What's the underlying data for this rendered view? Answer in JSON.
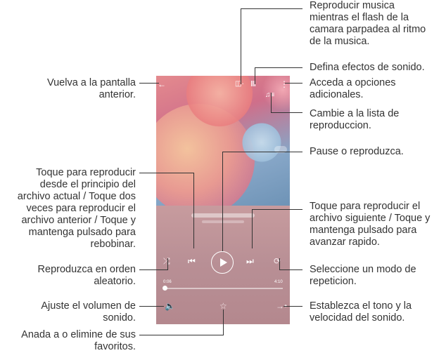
{
  "screen": {
    "elapsed": "0:06",
    "duration": "4:10",
    "progress": 0.02
  },
  "icons": {
    "back": "back-arrow-icon",
    "flash": "camera-flash-icon",
    "equalizer": "equalizer-icon",
    "more": "more-options-icon",
    "playlist": "playlist-icon",
    "shuffle": "shuffle-icon",
    "previous": "previous-track-icon",
    "play": "play-icon",
    "next": "next-track-icon",
    "repeat": "repeat-icon",
    "volume": "volume-icon",
    "favorite": "star-icon",
    "pitch": "pitch-speed-icon"
  },
  "annotations": {
    "flash": "Reproducir musica mientras el flash de la camara parpadea al ritmo de la musica.",
    "flash_lines": [
      "Reproducir musica",
      "mientras el flash de la",
      "camara parpadea al ritmo",
      "de la musica."
    ],
    "effects": "Defina efectos de sonido.",
    "more_lines": [
      "Acceda a opciones",
      "adicionales."
    ],
    "playlist_lines": [
      "Cambie a la lista de",
      "reproduccion."
    ],
    "pause": "Pause o reproduzca.",
    "back_lines": [
      "Vuelva a la pantalla",
      "anterior."
    ],
    "previous_lines": [
      "Toque para reproducir",
      "desde el principio del",
      "archivo actual / Toque dos",
      "veces para reproducir el",
      "archivo anterior / Toque y",
      "mantenga pulsado para",
      "rebobinar."
    ],
    "next_lines": [
      "Toque para reproducir el",
      "archivo siguiente / Toque y",
      "mantenga pulsado para",
      "avanzar rapido."
    ],
    "shuffle_lines": [
      "Reproduzca en orden",
      "aleatorio."
    ],
    "repeat_lines": [
      "Seleccione un modo de",
      "repeticion."
    ],
    "volume_lines": [
      "Ajuste el volumen de",
      "sonido."
    ],
    "pitch_lines": [
      "Establezca el tono y la",
      "velocidad del sonido."
    ],
    "favorite_lines": [
      "Anada a o elimine de sus",
      "favoritos."
    ]
  }
}
